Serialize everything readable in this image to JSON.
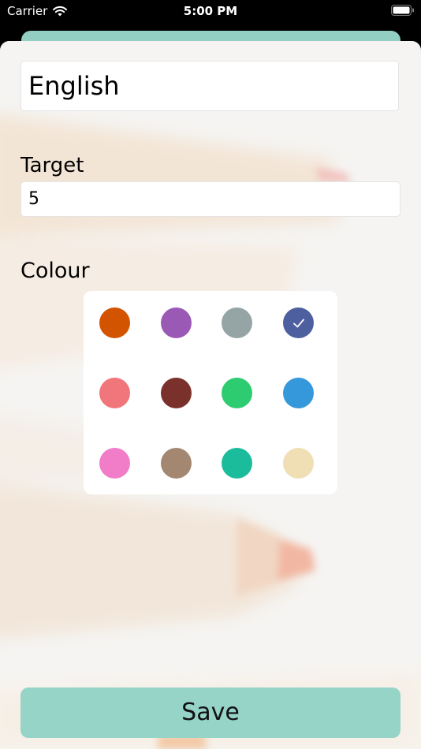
{
  "status_bar": {
    "carrier": "Carrier",
    "time": "5:00 PM"
  },
  "form": {
    "name_value": "English",
    "target_label": "Target",
    "target_value": "5",
    "colour_label": "Colour",
    "save_label": "Save"
  },
  "palette": {
    "selected": "indigo",
    "swatches": [
      {
        "id": "orange",
        "color": "#d35400"
      },
      {
        "id": "purple",
        "color": "#9b59b6"
      },
      {
        "id": "gray",
        "color": "#95a5a6"
      },
      {
        "id": "indigo",
        "color": "#4e5fa0"
      },
      {
        "id": "salmon",
        "color": "#f0767b"
      },
      {
        "id": "maroon",
        "color": "#7a312b"
      },
      {
        "id": "green",
        "color": "#2ecc71"
      },
      {
        "id": "blue",
        "color": "#3498db"
      },
      {
        "id": "pink",
        "color": "#f17cc8"
      },
      {
        "id": "taupe",
        "color": "#a38770"
      },
      {
        "id": "teal",
        "color": "#1abc9c"
      },
      {
        "id": "cream",
        "color": "#f0dfb5"
      }
    ]
  },
  "colors": {
    "accent": "#96d4c8",
    "sheet_background": "#f4f3f1"
  }
}
